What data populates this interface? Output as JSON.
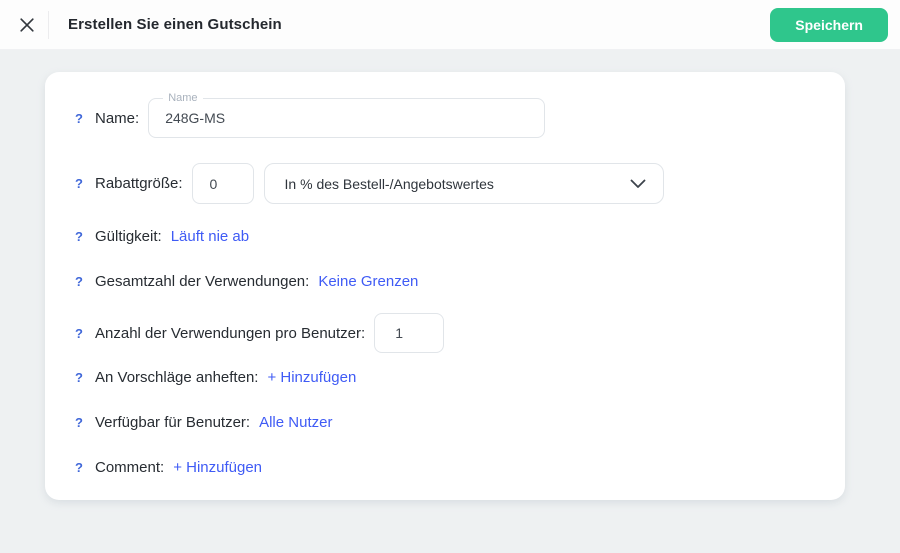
{
  "header": {
    "title": "Erstellen Sie einen Gutschein",
    "save_button": "Speichern"
  },
  "icons": {
    "help_glyph": "?"
  },
  "colors": {
    "accent_green": "#2fc68c",
    "link_blue": "#3f5bf5",
    "help_blue": "#4168d9",
    "page_background": "#eef1f2"
  },
  "form": {
    "name": {
      "label": "Name:",
      "floating_label": "Name",
      "value": "248G-MS"
    },
    "discount": {
      "label": "Rabattgröße:",
      "value": "0",
      "type_selected": "In % des Bestell-/Angebotswertes"
    },
    "validity": {
      "label": "Gültigkeit:",
      "value": "Läuft nie ab"
    },
    "total_uses": {
      "label": "Gesamtzahl der Verwendungen:",
      "value": "Keine Grenzen"
    },
    "uses_per_user": {
      "label": "Anzahl der Verwendungen pro Benutzer:",
      "value": "1"
    },
    "pin_to_proposals": {
      "label": "An Vorschläge anheften:",
      "value": "+ Hinzufügen"
    },
    "available_for_users": {
      "label": "Verfügbar für Benutzer:",
      "value": "Alle Nutzer"
    },
    "comment": {
      "label": "Comment:",
      "value": "+ Hinzufügen"
    }
  }
}
